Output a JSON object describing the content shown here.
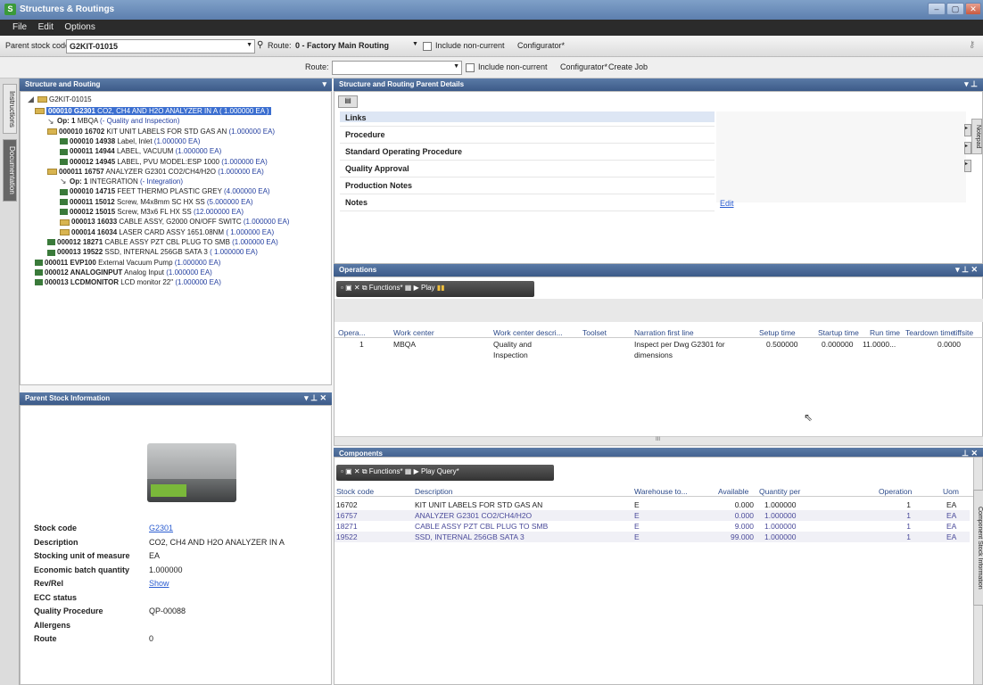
{
  "window": {
    "title": "Structures & Routings",
    "app_icon": "S",
    "min": "–",
    "max": "▢",
    "close": "✕"
  },
  "menu": [
    "File",
    "Edit",
    "Options"
  ],
  "toolbar": {
    "parent_label": "Parent stock code:",
    "parent_value": "G2KIT-01015",
    "route_label": "Route:",
    "route_value": "0 - Factory Main Routing",
    "include_noncurrent": "Include non-current",
    "configurator": "Configurator*"
  },
  "toolbar2": {
    "route_label": "Route:",
    "include_noncurrent": "Include non-current",
    "configurator": "Configurator*",
    "create_job": "Create Job"
  },
  "left_tabs": [
    "Instructions",
    "Documentation"
  ],
  "tree": {
    "title": "Structure and Routing",
    "root": "G2KIT-01015",
    "items": [
      {
        "code": "000010 G2301",
        "desc": "CO2, CH4 AND H2O ANALYZER IN A",
        "qty": "1.000000 EA",
        "icon": "folder",
        "level": 1,
        "selected": true
      },
      {
        "code": "Op: 1",
        "desc": "MBQA",
        "qty": "(- Quality and Inspection)",
        "icon": "op",
        "level": 2
      },
      {
        "code": "000010 16702",
        "desc": "KIT UNIT LABELS FOR STD GAS AN",
        "qty": "(1.000000 EA)",
        "icon": "folder",
        "level": 2
      },
      {
        "code": "000010 14938",
        "desc": "Label, Inlet",
        "qty": "(1.000000 EA)",
        "icon": "stock",
        "level": 3
      },
      {
        "code": "000011 14944",
        "desc": "LABEL, VACUUM",
        "qty": "(1.000000 EA)",
        "icon": "stock",
        "level": 3
      },
      {
        "code": "000012 14945",
        "desc": "LABEL, PVU MODEL:ESP 1000",
        "qty": "(1.000000 EA)",
        "icon": "stock",
        "level": 3
      },
      {
        "code": "000011 16757",
        "desc": "ANALYZER G2301 CO2/CH4/H2O",
        "qty": "(1.000000 EA)",
        "icon": "folder",
        "level": 2
      },
      {
        "code": "Op: 1",
        "desc": "INTEGRATION",
        "qty": "(- Integration)",
        "icon": "op",
        "level": 3
      },
      {
        "code": "000010 14715",
        "desc": "FEET THERMO PLASTIC GREY",
        "qty": "(4.000000 EA)",
        "icon": "stock",
        "level": 3
      },
      {
        "code": "000011 15012",
        "desc": "Screw, M4x8mm SC HX SS",
        "qty": "(5.000000 EA)",
        "icon": "stock",
        "level": 3
      },
      {
        "code": "000012 15015",
        "desc": "Screw, M3x6 FL HX SS",
        "qty": "(12.000000 EA)",
        "icon": "stock",
        "level": 3
      },
      {
        "code": "000013 16033",
        "desc": "CABLE ASSY, G2000 ON/OFF SWITC",
        "qty": "(1.000000 EA)",
        "icon": "folder",
        "level": 3
      },
      {
        "code": "000014 16034",
        "desc": "LASER CARD ASSY 1651.08NM",
        "qty": "( 1.000000 EA)",
        "icon": "folder",
        "level": 3
      },
      {
        "code": "000012 18271",
        "desc": "CABLE ASSY PZT CBL PLUG TO SMB",
        "qty": "(1.000000 EA)",
        "icon": "stock",
        "level": 2
      },
      {
        "code": "000013 19522",
        "desc": "SSD, INTERNAL 256GB SATA 3",
        "qty": "( 1.000000 EA)",
        "icon": "stock",
        "level": 2
      },
      {
        "code": "000011 EVP100",
        "desc": "External Vacuum Pump",
        "qty": "(1.000000 EA)",
        "icon": "stock",
        "level": 1
      },
      {
        "code": "000012 ANALOGINPUT",
        "desc": "Analog Input",
        "qty": "(1.000000 EA)",
        "icon": "stock",
        "level": 1
      },
      {
        "code": "000013 LCDMONITOR",
        "desc": "LCD monitor 22\"",
        "qty": "(1.000000 EA)",
        "icon": "stock",
        "level": 1
      }
    ]
  },
  "parent_info": {
    "title": "Parent Stock Information",
    "fields": [
      {
        "label": "Stock code",
        "value": "G2301",
        "link": true
      },
      {
        "label": "Description",
        "value": "CO2, CH4 AND H2O ANALYZER IN A"
      },
      {
        "label": "Stocking unit of measure",
        "value": "EA"
      },
      {
        "label": "Economic batch quantity",
        "value": "1.000000"
      },
      {
        "label": "Rev/Rel",
        "value": "Show",
        "link": true
      },
      {
        "label": "ECC status",
        "value": ""
      },
      {
        "label": "Quality Procedure",
        "value": "QP-00088"
      },
      {
        "label": "Allergens",
        "value": ""
      },
      {
        "label": "Route",
        "value": "0"
      }
    ]
  },
  "details": {
    "title": "Structure and Routing Parent Details",
    "rows": [
      "Links",
      "Procedure",
      "Standard Operating Procedure",
      "Quality Approval",
      "Production Notes",
      "Notes"
    ],
    "edit_link": "Edit",
    "side_tab": "Notepad"
  },
  "operations": {
    "title": "Operations",
    "toolbar": {
      "functions": "Functions*",
      "play": "Play"
    },
    "columns": [
      "Opera...",
      "Work center",
      "Work center descri...",
      "Toolset",
      "Narration first line",
      "Setup time",
      "Startup time",
      "Run time",
      "Teardown time",
      "tiffsite"
    ],
    "rows": [
      {
        "op": "1",
        "wc": "MBQA",
        "wcd1": "Quality and",
        "wcd2": "Inspection",
        "toolset": "",
        "narr1": "Inspect per Dwg G2301 for",
        "narr2": "dimensions",
        "setup": "0.500000",
        "startup": "0.000000",
        "run": "11.0000...",
        "teardown": "0.0000"
      }
    ],
    "scroll_mark": "III"
  },
  "components": {
    "title": "Components",
    "toolbar": {
      "functions": "Functions*",
      "play": "Play",
      "query": "Query*"
    },
    "columns": [
      "Stock code",
      "Description",
      "Warehouse to...",
      "Available",
      "Quantity per",
      "Operation",
      "Uom"
    ],
    "rows": [
      {
        "code": "16702",
        "desc": "KIT UNIT LABELS FOR STD GAS AN",
        "wh": "E",
        "avail": "0.000",
        "qty": "1.000000",
        "op": "1",
        "uom": "EA"
      },
      {
        "code": "16757",
        "desc": "ANALYZER G2301 CO2/CH4/H2O",
        "wh": "E",
        "avail": "0.000",
        "qty": "1.000000",
        "op": "1",
        "uom": "EA"
      },
      {
        "code": "18271",
        "desc": "CABLE ASSY PZT CBL PLUG TO SMB",
        "wh": "E",
        "avail": "9.000",
        "qty": "1.000000",
        "op": "1",
        "uom": "EA"
      },
      {
        "code": "19522",
        "desc": "SSD, INTERNAL 256GB SATA 3",
        "wh": "E",
        "avail": "99.000",
        "qty": "1.000000",
        "op": "1",
        "uom": "EA"
      }
    ],
    "side_tab": "Component Stock Information"
  }
}
